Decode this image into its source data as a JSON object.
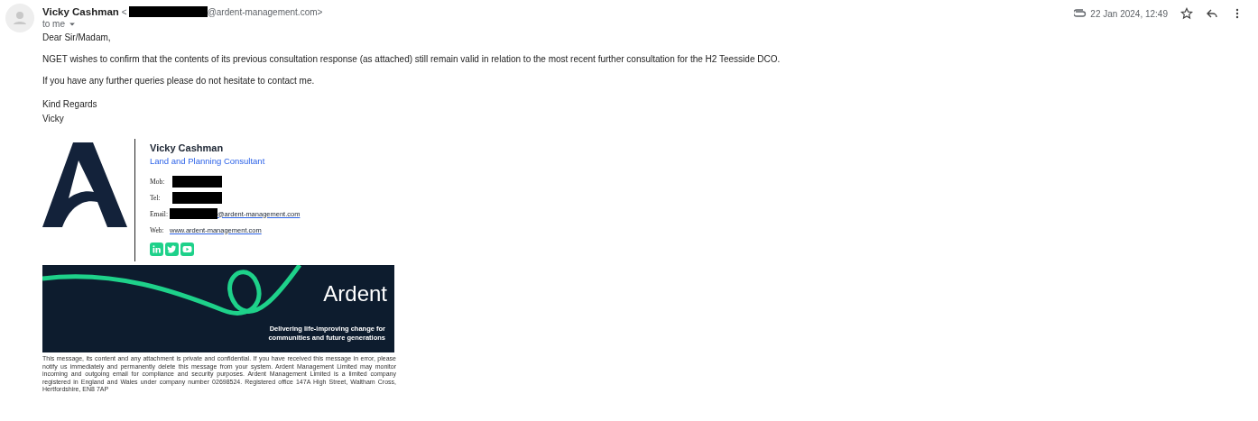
{
  "sender": {
    "name": "Vicky Cashman",
    "separator": "<",
    "address_suffix": "@ardent-management.com>",
    "recipient": "to me"
  },
  "meta": {
    "date": "22 Jan 2024, 12:49"
  },
  "body": [
    "Dear Sir/Madam,",
    "NGET wishes to confirm that the contents of its previous consultation response (as attached) still remain valid in relation to the most recent further consultation for the H2 Teesside DCO.",
    "If you have any further queries please do not hesitate to contact me."
  ],
  "closing": [
    "Kind Regards",
    "Vicky"
  ],
  "signature": {
    "name": "Vicky Cashman",
    "role": "Land and Planning Consultant",
    "contacts": [
      {
        "label": "Mob:",
        "kind": "redacted"
      },
      {
        "label": "Tel:",
        "kind": "redacted"
      },
      {
        "label": "Email:",
        "kind": "email",
        "value": "@ardent-management.com"
      },
      {
        "label": "Web:",
        "kind": "link",
        "value": "www.ardent-management.com"
      }
    ]
  },
  "banner": {
    "brand": "Ardent",
    "tagline": "Delivering life-improving change for communities and future generations"
  },
  "disclaimer": "This message, its content and any attachment is private and confidential.  If you have received this message in error, please notify us immediately and permanently delete this message from your system.  Ardent Management Limited may monitor incoming and outgoing email for compliance and security purposes. Ardent Management Limited is a limited company registered in England and Wales under company number 02698524.  Registered office 147A High Street, Waltham Cross, Hertfordshire, EN8 7AP"
}
